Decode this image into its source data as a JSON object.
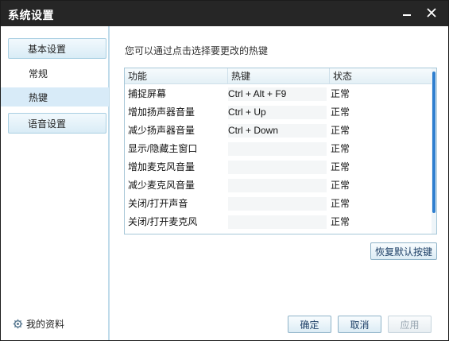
{
  "window": {
    "title": "系统设置"
  },
  "sidebar": {
    "groups": [
      {
        "label": "基本设置",
        "items": [
          "常规",
          "热键"
        ]
      },
      {
        "label": "语音设置",
        "items": []
      }
    ],
    "active": "热键",
    "profile_label": "我的资料"
  },
  "main": {
    "hint": "您可以通过点击选择要更改的热键",
    "table": {
      "columns": [
        "功能",
        "热键",
        "状态"
      ],
      "rows": [
        [
          "捕捉屏幕",
          "Ctrl + Alt + F9",
          "正常"
        ],
        [
          "增加扬声器音量",
          "Ctrl + Up",
          "正常"
        ],
        [
          "减少扬声器音量",
          "Ctrl + Down",
          "正常"
        ],
        [
          "显示/隐藏主窗口",
          "",
          "正常"
        ],
        [
          "增加麦克风音量",
          "",
          "正常"
        ],
        [
          "减少麦克风音量",
          "",
          "正常"
        ],
        [
          "关闭/打开声音",
          "",
          "正常"
        ],
        [
          "关闭/打开麦克风",
          "",
          "正常"
        ]
      ]
    },
    "restore_label": "恢复默认按键"
  },
  "footer": {
    "ok_label": "确定",
    "cancel_label": "取消",
    "apply_label": "应用"
  }
}
